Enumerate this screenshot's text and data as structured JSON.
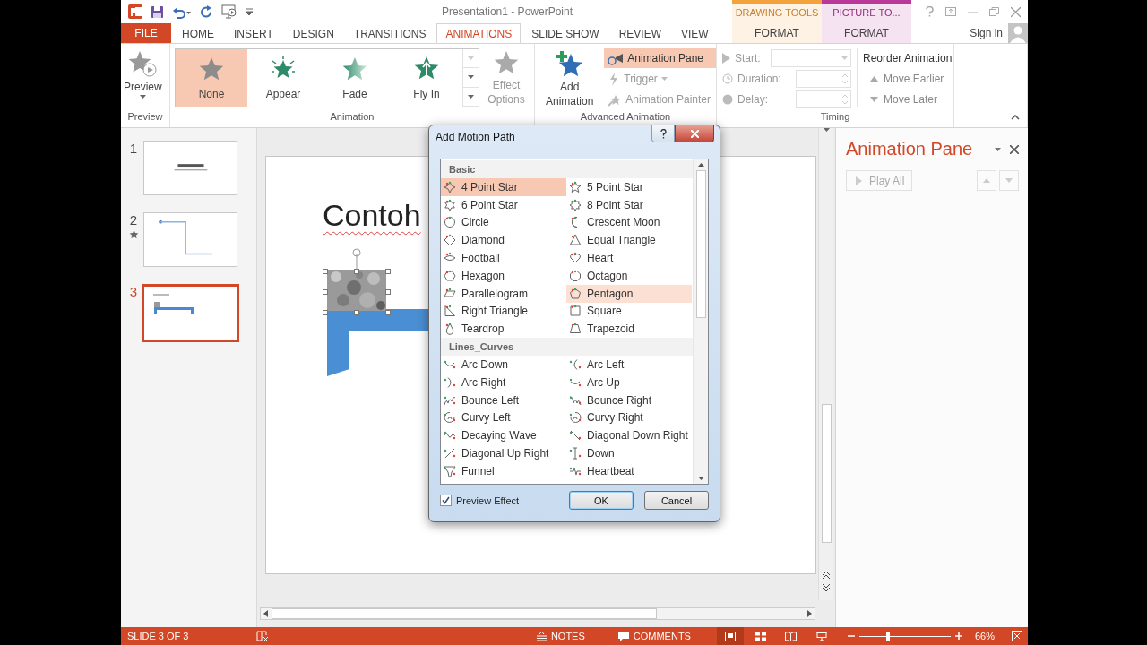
{
  "window": {
    "title": "Presentation1 - PowerPoint"
  },
  "contextual_groups": [
    {
      "label": "DRAWING TOOLS",
      "tab": "FORMAT",
      "color": "#f4a23c"
    },
    {
      "label": "PICTURE TO...",
      "tab": "FORMAT",
      "color": "#b8399a"
    }
  ],
  "tabs": [
    {
      "label": "FILE",
      "kind": "file",
      "selected": false
    },
    {
      "label": "HOME",
      "kind": "tab",
      "selected": false
    },
    {
      "label": "INSERT",
      "kind": "tab",
      "selected": false
    },
    {
      "label": "DESIGN",
      "kind": "tab",
      "selected": false
    },
    {
      "label": "TRANSITIONS",
      "kind": "tab",
      "selected": false
    },
    {
      "label": "ANIMATIONS",
      "kind": "tab",
      "selected": true
    },
    {
      "label": "SLIDE SHOW",
      "kind": "tab",
      "selected": false
    },
    {
      "label": "REVIEW",
      "kind": "tab",
      "selected": false
    },
    {
      "label": "VIEW",
      "kind": "tab",
      "selected": false
    }
  ],
  "account": {
    "label": "Sign in"
  },
  "ribbon": {
    "preview": {
      "button": "Preview",
      "group": "Preview"
    },
    "animation": {
      "group": "Animation",
      "gallery": [
        {
          "label": "None",
          "selected": true
        },
        {
          "label": "Appear",
          "selected": false
        },
        {
          "label": "Fade",
          "selected": false
        },
        {
          "label": "Fly In",
          "selected": false
        }
      ],
      "effect_options": {
        "label": "Effect Options",
        "disabled": true
      }
    },
    "advanced": {
      "group": "Advanced Animation",
      "add_animation": "Add Animation",
      "commands": [
        {
          "label": "Animation Pane",
          "selected": true,
          "disabled": false
        },
        {
          "label": "Trigger",
          "selected": false,
          "disabled": true
        },
        {
          "label": "Animation Painter",
          "selected": false,
          "disabled": true
        }
      ]
    },
    "timing": {
      "group": "Timing",
      "fields": [
        {
          "label": "Start:",
          "kind": "combo",
          "disabled": true
        },
        {
          "label": "Duration:",
          "kind": "spinner",
          "disabled": true
        },
        {
          "label": "Delay:",
          "kind": "spinner",
          "disabled": true
        }
      ],
      "reorder": {
        "title": "Reorder Animation",
        "commands": [
          {
            "label": "Move Earlier",
            "disabled": true
          },
          {
            "label": "Move Later",
            "disabled": true
          }
        ]
      }
    }
  },
  "slides": [
    {
      "number": "1",
      "selected": false,
      "animated": false
    },
    {
      "number": "2",
      "selected": false,
      "animated": true
    },
    {
      "number": "3",
      "selected": true,
      "animated": false
    }
  ],
  "slide": {
    "title": "Contoh"
  },
  "dialog": {
    "title": "Add Motion Path",
    "sections": [
      {
        "heading": "Basic",
        "items": [
          {
            "label": "4 Point Star",
            "selected": true,
            "hovered": false
          },
          {
            "label": "5 Point Star",
            "selected": false,
            "hovered": false
          },
          {
            "label": "6 Point Star",
            "selected": false,
            "hovered": false
          },
          {
            "label": "8 Point Star",
            "selected": false,
            "hovered": false
          },
          {
            "label": "Circle",
            "selected": false,
            "hovered": false
          },
          {
            "label": "Crescent Moon",
            "selected": false,
            "hovered": false
          },
          {
            "label": "Diamond",
            "selected": false,
            "hovered": false
          },
          {
            "label": "Equal Triangle",
            "selected": false,
            "hovered": false
          },
          {
            "label": "Football",
            "selected": false,
            "hovered": false
          },
          {
            "label": "Heart",
            "selected": false,
            "hovered": false
          },
          {
            "label": "Hexagon",
            "selected": false,
            "hovered": false
          },
          {
            "label": "Octagon",
            "selected": false,
            "hovered": false
          },
          {
            "label": "Parallelogram",
            "selected": false,
            "hovered": false
          },
          {
            "label": "Pentagon",
            "selected": false,
            "hovered": true
          },
          {
            "label": "Right Triangle",
            "selected": false,
            "hovered": false
          },
          {
            "label": "Square",
            "selected": false,
            "hovered": false
          },
          {
            "label": "Teardrop",
            "selected": false,
            "hovered": false
          },
          {
            "label": "Trapezoid",
            "selected": false,
            "hovered": false
          }
        ]
      },
      {
        "heading": "Lines_Curves",
        "items": [
          {
            "label": "Arc Down",
            "selected": false,
            "hovered": false
          },
          {
            "label": "Arc Left",
            "selected": false,
            "hovered": false
          },
          {
            "label": "Arc Right",
            "selected": false,
            "hovered": false
          },
          {
            "label": "Arc Up",
            "selected": false,
            "hovered": false
          },
          {
            "label": "Bounce Left",
            "selected": false,
            "hovered": false
          },
          {
            "label": "Bounce Right",
            "selected": false,
            "hovered": false
          },
          {
            "label": "Curvy Left",
            "selected": false,
            "hovered": false
          },
          {
            "label": "Curvy Right",
            "selected": false,
            "hovered": false
          },
          {
            "label": "Decaying Wave",
            "selected": false,
            "hovered": false
          },
          {
            "label": "Diagonal Down Right",
            "selected": false,
            "hovered": false
          },
          {
            "label": "Diagonal Up Right",
            "selected": false,
            "hovered": false
          },
          {
            "label": "Down",
            "selected": false,
            "hovered": false
          },
          {
            "label": "Funnel",
            "selected": false,
            "hovered": false
          },
          {
            "label": "Heartbeat",
            "selected": false,
            "hovered": false
          }
        ]
      }
    ],
    "preview_effect": {
      "label": "Preview Effect",
      "checked": true
    },
    "buttons": [
      {
        "label": "OK",
        "default": true
      },
      {
        "label": "Cancel",
        "default": false
      }
    ]
  },
  "animation_pane": {
    "title": "Animation Pane",
    "play_all": {
      "label": "Play All",
      "disabled": true
    }
  },
  "status_bar": {
    "slide": "SLIDE 3 OF 3",
    "notes": "NOTES",
    "comments": "COMMENTS",
    "views": [
      {
        "selected": true
      },
      {
        "selected": false
      },
      {
        "selected": false
      },
      {
        "selected": false
      }
    ],
    "zoom": {
      "level": 0.31,
      "reading": "66%"
    }
  }
}
